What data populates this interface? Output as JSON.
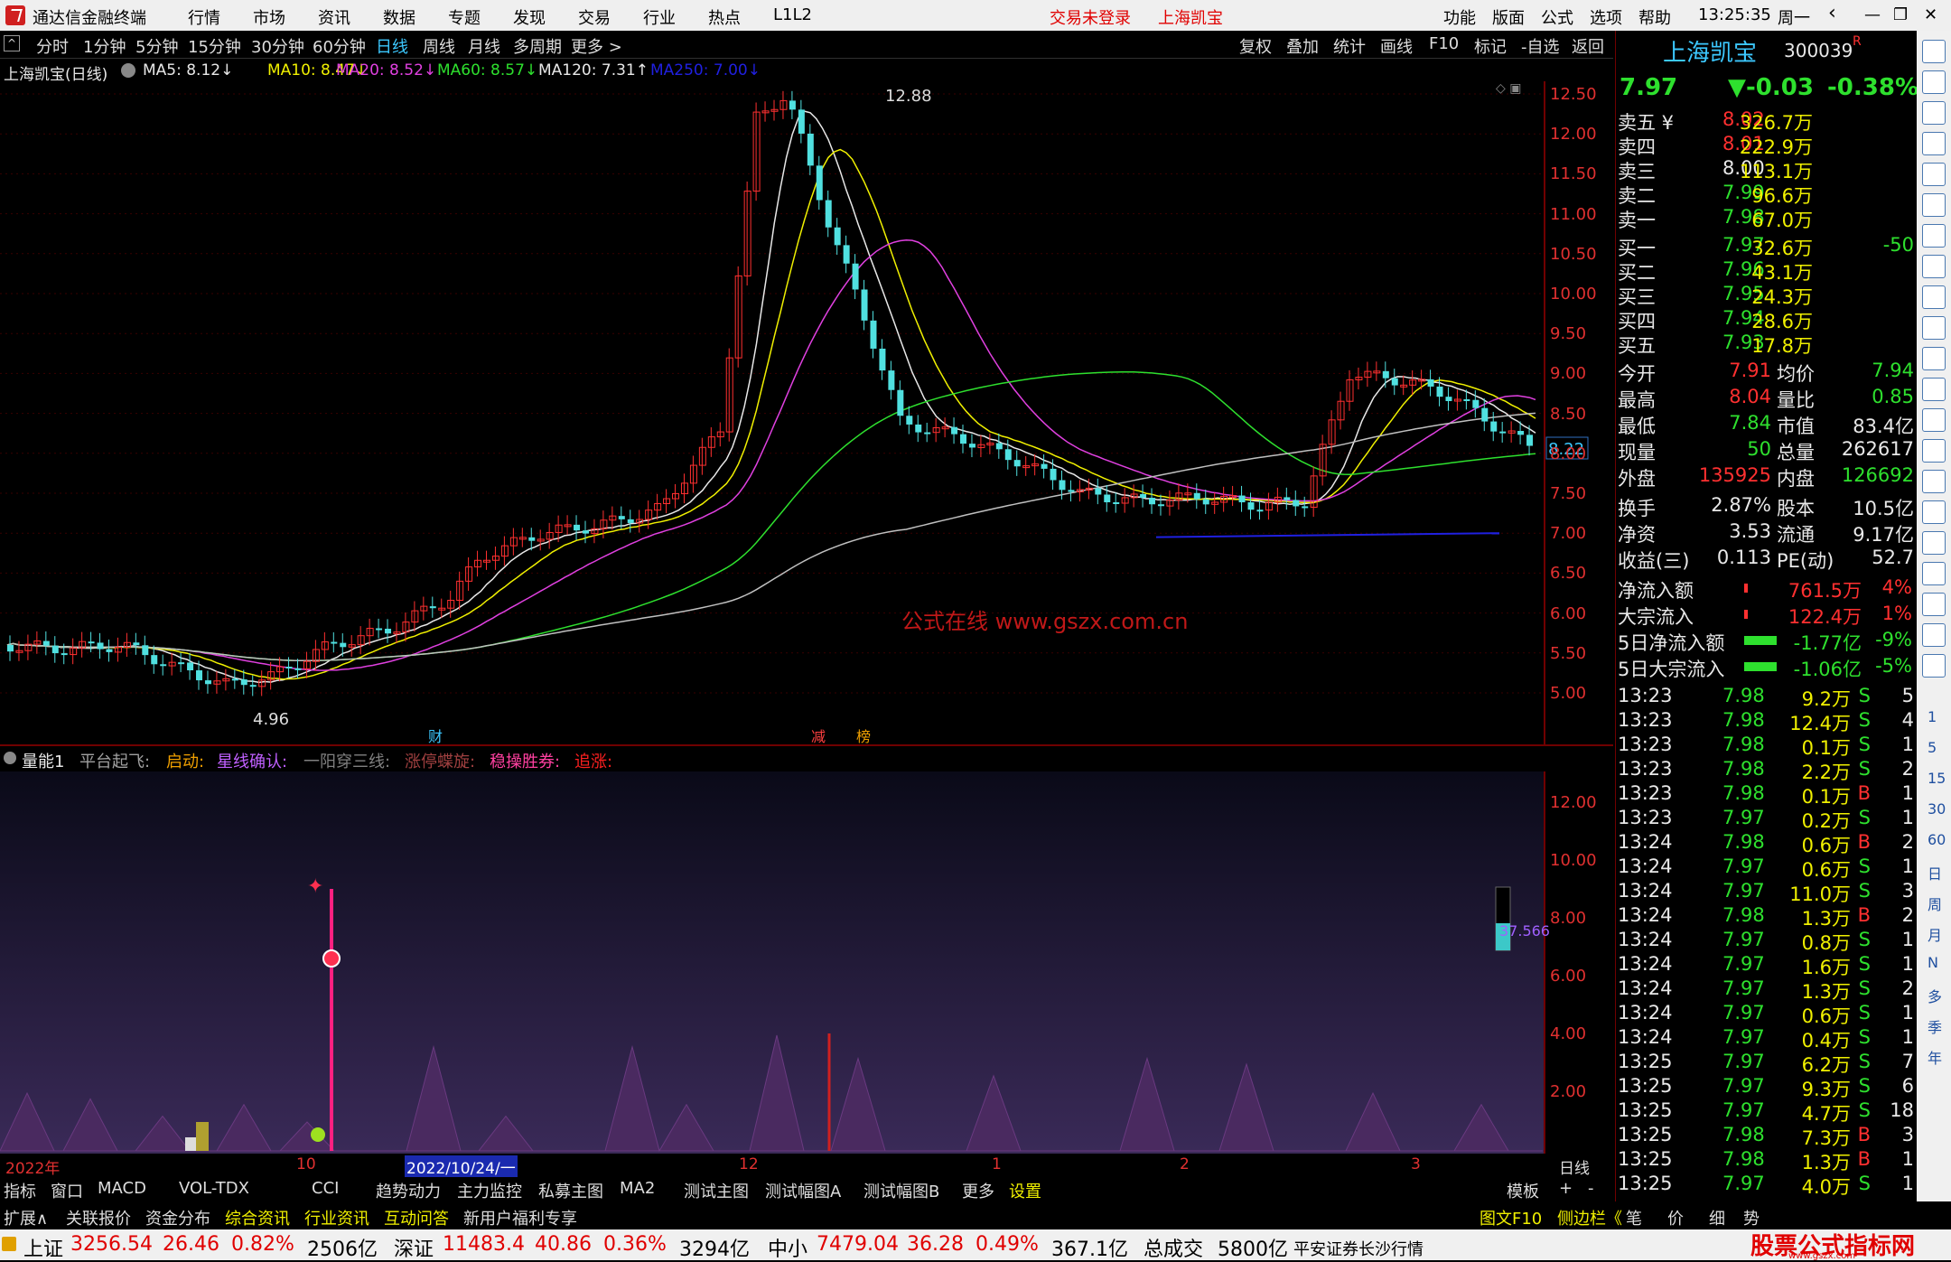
{
  "titlebar": {
    "app_name": "通达信金融终端",
    "menus": [
      "行情",
      "市场",
      "资讯",
      "数据",
      "专题",
      "发现",
      "交易",
      "行业",
      "热点",
      "L1L2"
    ],
    "login_status": "交易未登录",
    "stock_title": "上海凯宝",
    "right_menus": [
      "功能",
      "版面",
      "公式",
      "选项",
      "帮助"
    ],
    "time": "13:25:35",
    "weekday": "周一"
  },
  "periods": {
    "items": [
      "分时",
      "1分钟",
      "5分钟",
      "15分钟",
      "30分钟",
      "60分钟",
      "日线",
      "周线",
      "月线",
      "多周期",
      "更多 >"
    ],
    "active": "日线",
    "tools": [
      "复权",
      "叠加",
      "统计",
      "画线",
      "F10",
      "标记",
      "-自选",
      "返回"
    ]
  },
  "ma_line": {
    "stock_label": "上海凯宝(日线)",
    "ma": [
      {
        "text": "MA5: 8.12↓",
        "color": "#e8e8e8"
      },
      {
        "text": "MA10: 8.47↓",
        "color": "#f0f000"
      },
      {
        "text": "MA20: 8.52↓",
        "color": "#e040e0"
      },
      {
        "text": "MA60: 8.57↓",
        "color": "#2ee02e"
      },
      {
        "text": "MA120: 7.31↑",
        "color": "#e8e8e8"
      },
      {
        "text": "MA250: 7.00↓",
        "color": "#2020e0"
      }
    ]
  },
  "main_chart": {
    "price_axis": [
      "12.50",
      "12.00",
      "11.50",
      "11.00",
      "10.50",
      "10.00",
      "9.50",
      "9.00",
      "8.50",
      "8.00",
      "7.50",
      "7.00",
      "6.50",
      "6.00",
      "5.50",
      "5.00"
    ],
    "current_price_tag": "8.22",
    "high_label": "12.88",
    "low_label": "4.96",
    "watermark": "公式在线 www.gszx.com.cn",
    "event_marks": [
      "财",
      "减",
      "榜"
    ]
  },
  "indicator": {
    "name": "量能1",
    "signals": [
      {
        "text": "平台起飞:",
        "color": "#a0a0a0"
      },
      {
        "text": "启动:",
        "color": "#f0a000"
      },
      {
        "text": "星线确认:",
        "color": "#c060ff"
      },
      {
        "text": "一阳穿三线:",
        "color": "#808080"
      },
      {
        "text": "涨停蝶旋:",
        "color": "#a04040"
      },
      {
        "text": "稳操胜券:",
        "color": "#ff40a0"
      },
      {
        "text": "追涨:",
        "color": "#ff2020"
      }
    ],
    "axis": [
      "12.00",
      "10.00",
      "8.00",
      "6.00",
      "4.00",
      "2.00"
    ],
    "value_tag": "37.566"
  },
  "date_axis": {
    "labels": [
      "2022年",
      "10",
      "2022/10/24/一",
      "12",
      "1",
      "2",
      "3"
    ],
    "period": "日线"
  },
  "tabs_row1": [
    "指标",
    "窗口",
    "MACD",
    "VOL-TDX",
    "CCI",
    "趋势动力",
    "主力监控",
    "私募主图",
    "MA2",
    "测试主图",
    "测试幅图A",
    "测试幅图B",
    "更多",
    "设置"
  ],
  "tabs_row1_right": [
    "模板",
    "+",
    "-"
  ],
  "tabs_row2": [
    {
      "text": "扩展∧",
      "color": "#ddd"
    },
    {
      "text": "关联报价",
      "color": "#ddd"
    },
    {
      "text": "资金分布",
      "color": "#ddd"
    },
    {
      "text": "综合资讯",
      "color": "#f0f000"
    },
    {
      "text": "行业资讯",
      "color": "#f0f000"
    },
    {
      "text": "互动问答",
      "color": "#f0f000"
    },
    {
      "text": "新用户福利专享",
      "color": "#ddd"
    }
  ],
  "tabs_row2_right": [
    "图文F10",
    "侧边栏《",
    "笔",
    "价",
    "细",
    "势"
  ],
  "quote": {
    "name": "上海凯宝",
    "code": "300039",
    "r_mark": "R",
    "price": "7.97",
    "change": "▼-0.03",
    "pct": "-0.38%",
    "sell": [
      {
        "label": "卖五 ¥",
        "price": "8.02",
        "vol": "326.7万"
      },
      {
        "label": "卖四",
        "price": "8.01",
        "vol": "222.9万"
      },
      {
        "label": "卖三",
        "price": "8.00",
        "vol": "113.1万"
      },
      {
        "label": "卖二",
        "price": "7.99",
        "vol": "96.6万"
      },
      {
        "label": "卖一",
        "price": "7.98",
        "vol": "67.0万"
      }
    ],
    "buy": [
      {
        "label": "买一",
        "price": "7.97",
        "vol": "32.6万",
        "extra": "-50"
      },
      {
        "label": "买二",
        "price": "7.96",
        "vol": "43.1万",
        "extra": ""
      },
      {
        "label": "买三",
        "price": "7.95",
        "vol": "24.3万",
        "extra": ""
      },
      {
        "label": "买四",
        "price": "7.94",
        "vol": "28.6万",
        "extra": ""
      },
      {
        "label": "买五",
        "price": "7.93",
        "vol": "17.8万",
        "extra": ""
      }
    ],
    "stats": [
      {
        "l1": "今开",
        "v1": "7.91",
        "c1": "r",
        "l2": "均价",
        "v2": "7.94",
        "c2": "g"
      },
      {
        "l1": "最高",
        "v1": "8.04",
        "c1": "r",
        "l2": "量比",
        "v2": "0.85",
        "c2": "g"
      },
      {
        "l1": "最低",
        "v1": "7.84",
        "c1": "g",
        "l2": "市值",
        "v2": "83.4亿",
        "c2": "w"
      },
      {
        "l1": "现量",
        "v1": "50",
        "c1": "g",
        "l2": "总量",
        "v2": "262617",
        "c2": "w"
      },
      {
        "l1": "外盘",
        "v1": "135925",
        "c1": "r",
        "l2": "内盘",
        "v2": "126692",
        "c2": "g"
      }
    ],
    "stats2": [
      {
        "l1": "换手",
        "v1": "2.87%",
        "l2": "股本",
        "v2": "10.5亿"
      },
      {
        "l1": "净资",
        "v1": "3.53",
        "l2": "流通",
        "v2": "9.17亿"
      },
      {
        "l1": "收益(三)",
        "v1": "0.113",
        "l2": "PE(动)",
        "v2": "52.7"
      }
    ],
    "flows": [
      {
        "label": "净流入额",
        "val": "761.5万",
        "pct": "4%",
        "color": "r"
      },
      {
        "label": "大宗流入",
        "val": "122.4万",
        "pct": "1%",
        "color": "r"
      },
      {
        "label": "5日净流入额",
        "val": "-1.77亿",
        "pct": "-9%",
        "color": "g"
      },
      {
        "label": "5日大宗流入",
        "val": "-1.06亿",
        "pct": "-5%",
        "color": "g"
      }
    ],
    "ticks": [
      {
        "t": "13:23",
        "p": "7.98",
        "v": "9.2万",
        "s": "S",
        "n": "5"
      },
      {
        "t": "13:23",
        "p": "7.98",
        "v": "12.4万",
        "s": "S",
        "n": "4"
      },
      {
        "t": "13:23",
        "p": "7.98",
        "v": "0.1万",
        "s": "S",
        "n": "1"
      },
      {
        "t": "13:23",
        "p": "7.98",
        "v": "2.2万",
        "s": "S",
        "n": "2"
      },
      {
        "t": "13:23",
        "p": "7.98",
        "v": "0.1万",
        "s": "B",
        "n": "1"
      },
      {
        "t": "13:23",
        "p": "7.97",
        "v": "0.2万",
        "s": "S",
        "n": "1"
      },
      {
        "t": "13:24",
        "p": "7.98",
        "v": "0.6万",
        "s": "B",
        "n": "2"
      },
      {
        "t": "13:24",
        "p": "7.97",
        "v": "0.6万",
        "s": "S",
        "n": "1"
      },
      {
        "t": "13:24",
        "p": "7.97",
        "v": "11.0万",
        "s": "S",
        "n": "3"
      },
      {
        "t": "13:24",
        "p": "7.98",
        "v": "1.3万",
        "s": "B",
        "n": "2"
      },
      {
        "t": "13:24",
        "p": "7.97",
        "v": "0.8万",
        "s": "S",
        "n": "1"
      },
      {
        "t": "13:24",
        "p": "7.97",
        "v": "1.6万",
        "s": "S",
        "n": "1"
      },
      {
        "t": "13:24",
        "p": "7.97",
        "v": "1.3万",
        "s": "S",
        "n": "2"
      },
      {
        "t": "13:24",
        "p": "7.97",
        "v": "0.6万",
        "s": "S",
        "n": "1"
      },
      {
        "t": "13:24",
        "p": "7.97",
        "v": "0.4万",
        "s": "S",
        "n": "1"
      },
      {
        "t": "13:25",
        "p": "7.97",
        "v": "6.2万",
        "s": "S",
        "n": "7"
      },
      {
        "t": "13:25",
        "p": "7.97",
        "v": "9.3万",
        "s": "S",
        "n": "6"
      },
      {
        "t": "13:25",
        "p": "7.97",
        "v": "4.7万",
        "s": "S",
        "n": "18"
      },
      {
        "t": "13:25",
        "p": "7.98",
        "v": "7.3万",
        "s": "B",
        "n": "3"
      },
      {
        "t": "13:25",
        "p": "7.98",
        "v": "1.3万",
        "s": "B",
        "n": "1"
      },
      {
        "t": "13:25",
        "p": "7.97",
        "v": "4.0万",
        "s": "S",
        "n": "1"
      }
    ]
  },
  "side_icons": [
    "up-arrow",
    "up-icon",
    "down-icon",
    "kline",
    "table",
    "line",
    "bars",
    "doc",
    "F10",
    "list",
    "F1",
    "F2",
    "F3",
    "clock",
    "chart",
    "RSI",
    "warn",
    "move",
    "pen",
    "F5",
    "rank"
  ],
  "side_labels": [
    "1",
    "5",
    "15",
    "30",
    "60",
    "日",
    "周",
    "月",
    "N",
    "多",
    "季",
    "年"
  ],
  "statusbar": {
    "sh_label": "上证",
    "sh_val": "3256.54",
    "sh_chg": "26.46",
    "sh_pct": "0.82%",
    "sh_amt": "2506亿",
    "sz_label": "深证",
    "sz_val": "11483.4",
    "sz_chg": "40.86",
    "sz_pct": "0.36%",
    "sz_amt": "3294亿",
    "zx_label": "中小",
    "zx_val": "7479.04",
    "zx_chg": "36.28",
    "zx_pct": "0.49%",
    "zx_amt": "367.1亿",
    "total_label": "总成交",
    "total_val": "5800亿",
    "broker": "平安证券长沙行情",
    "brand": "股票公式指标网",
    "brand_url": "www.gszx.com"
  }
}
